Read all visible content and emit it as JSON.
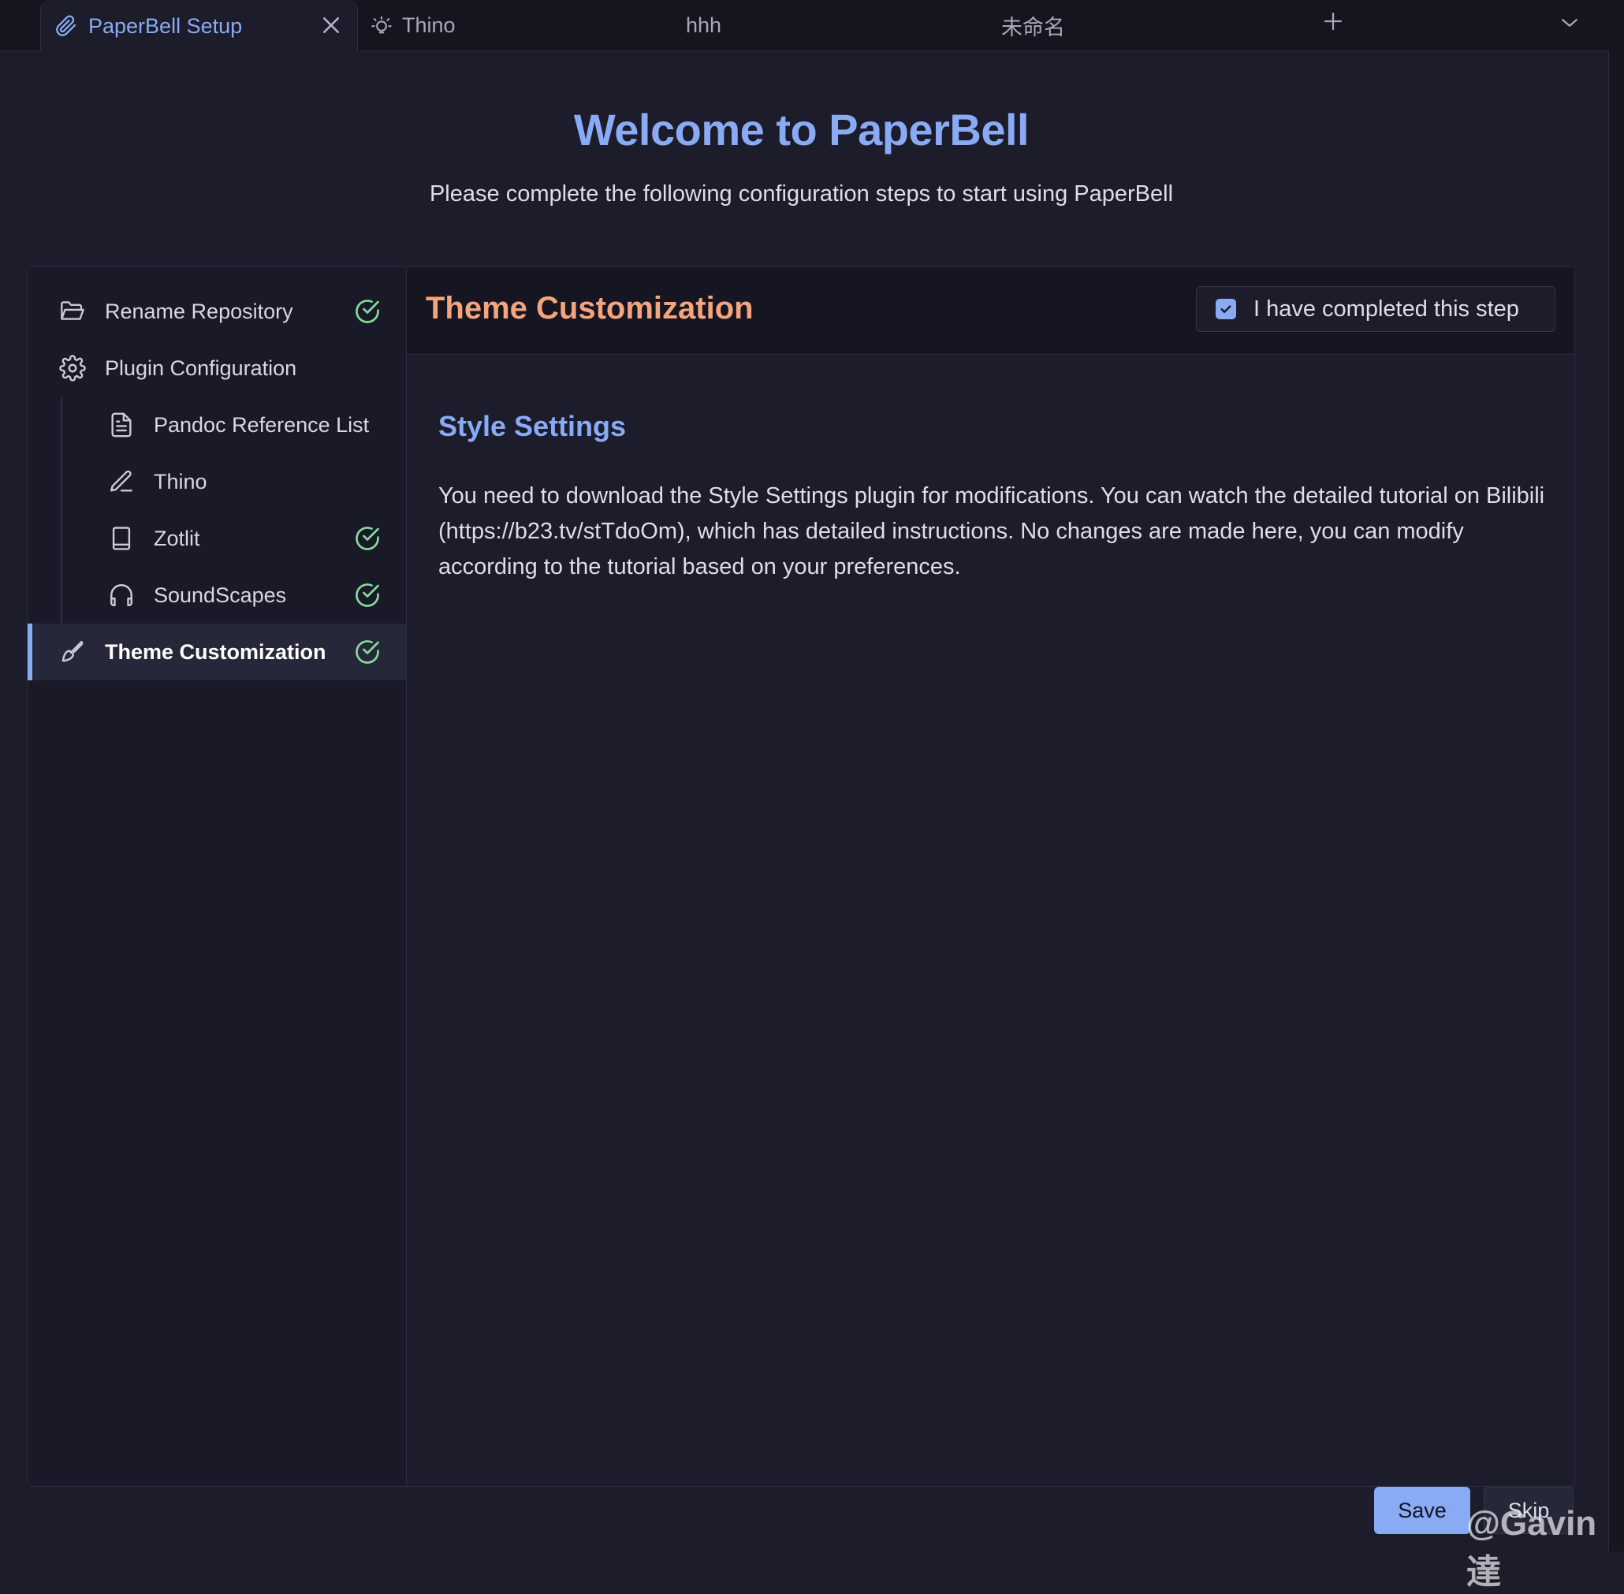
{
  "tabs": [
    {
      "label": "PaperBell Setup",
      "icon": "paperclip-icon",
      "active": true
    },
    {
      "label": "Thino",
      "icon": "lightbulb-icon"
    },
    {
      "label": "hhh"
    },
    {
      "label": "未命名"
    }
  ],
  "header": {
    "title": "Welcome to PaperBell",
    "subtitle": "Please complete the following configuration steps to start using PaperBell"
  },
  "sidebar": {
    "items": [
      {
        "label": "Rename Repository",
        "icon": "folder-open-icon",
        "completed": true
      },
      {
        "label": "Plugin Configuration",
        "icon": "gear-icon",
        "completed": false
      },
      {
        "label": "Pandoc Reference List",
        "icon": "document-icon",
        "completed": false
      },
      {
        "label": "Thino",
        "icon": "pen-icon",
        "completed": false
      },
      {
        "label": "Zotlit",
        "icon": "book-icon",
        "completed": true
      },
      {
        "label": "SoundScapes",
        "icon": "headphones-icon",
        "completed": true
      },
      {
        "label": "Theme Customization",
        "icon": "brush-icon",
        "completed": true,
        "active": true
      }
    ]
  },
  "content": {
    "step_title": "Theme Customization",
    "completed_label": "I have completed this step",
    "completed_checked": true,
    "section_title": "Style Settings",
    "section_text": "You need to download the Style Settings plugin for modifications. You can watch the detailed tutorial on Bilibili (https://b23.tv/stTdoOm), which has detailed instructions. No changes are made here, you can modify according to the tutorial based on your preferences."
  },
  "buttons": {
    "save": "Save",
    "skip": "Skip"
  },
  "watermark": "@Gavin達",
  "colors": {
    "accent": "#89aaf5",
    "step_title": "#f4a57c",
    "check": "#86d99a",
    "background": "#1c1c2a"
  }
}
